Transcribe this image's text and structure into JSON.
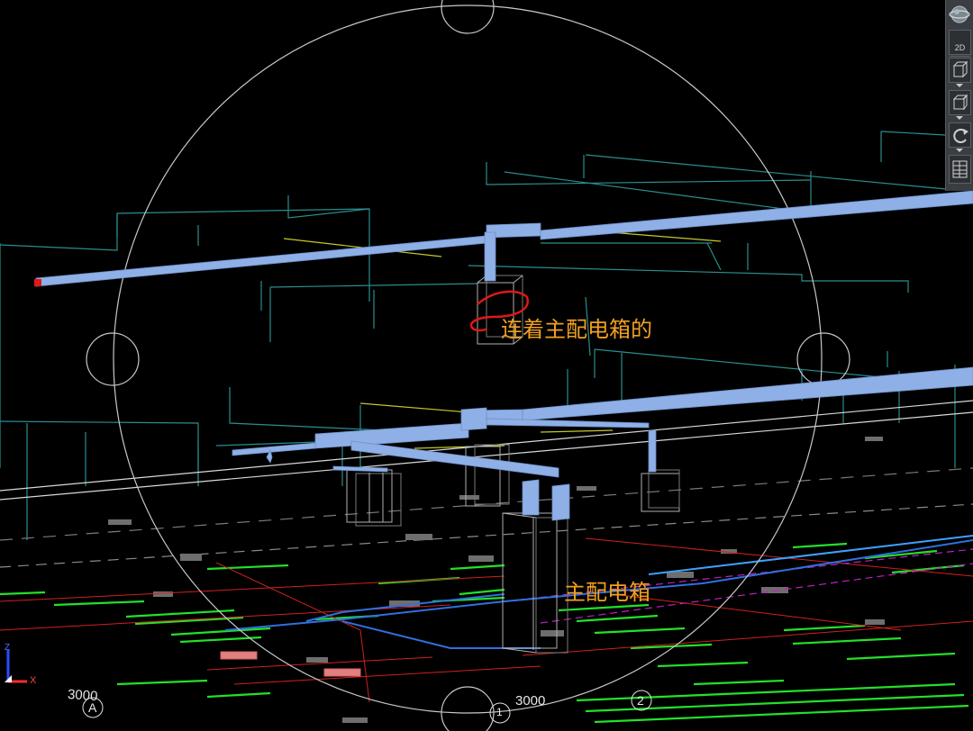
{
  "annotations": {
    "connected_label": "连着主配电箱的",
    "main_box_label": "主配电箱"
  },
  "dimensions": {
    "left": "3000",
    "right": "3000"
  },
  "grid_bubbles": {
    "a": "A",
    "one": "1",
    "two": "2"
  },
  "ucs": {
    "z": "Z",
    "x": "X"
  },
  "nav_bar": {
    "view_label": "2D",
    "buttons": [
      "orbit-globe-icon",
      "2d-view-icon",
      "view-cube-icon",
      "box-view-icon",
      "rotate-icon",
      "navigation-panel-icon"
    ]
  },
  "colors": {
    "duct": "#8fb0e6",
    "wireframe": "#2a8e8e",
    "markup": "#e01818",
    "annotation": "#f0a020",
    "green_layer": "#24e02a",
    "yellow_layer": "#c8c82a"
  }
}
